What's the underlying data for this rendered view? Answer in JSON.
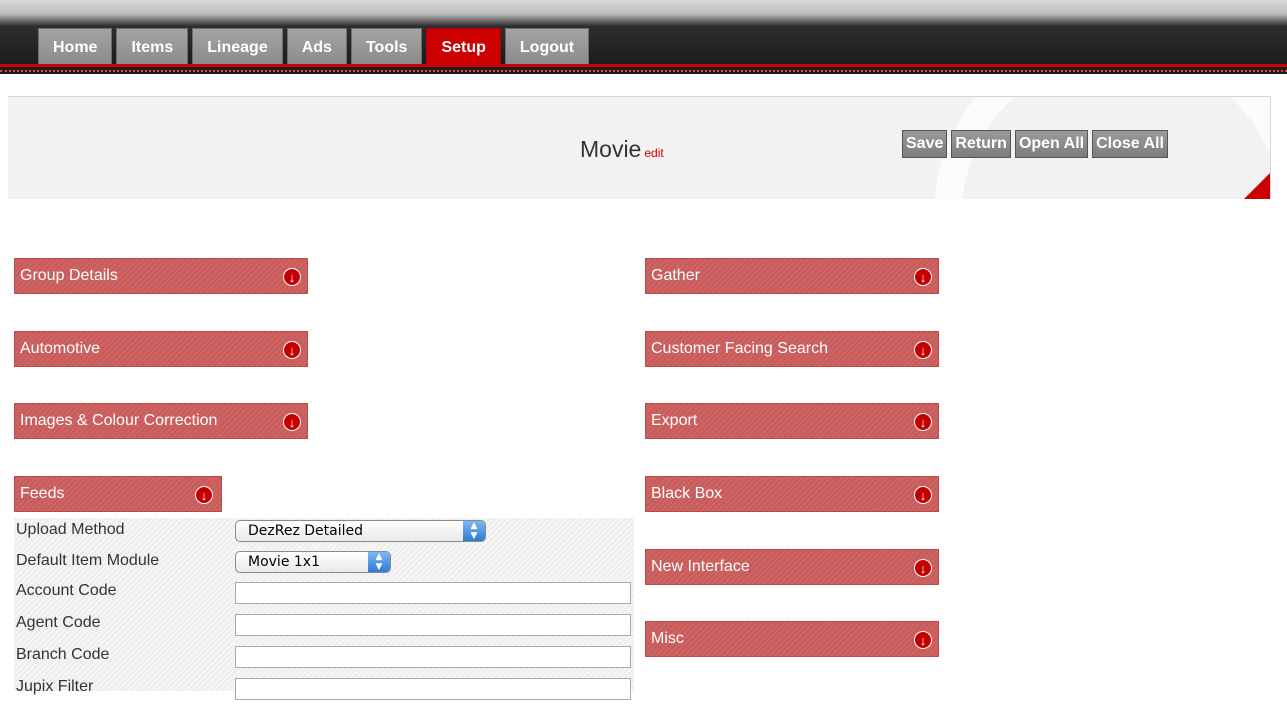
{
  "nav": {
    "tabs": [
      {
        "label": "Home"
      },
      {
        "label": "Items"
      },
      {
        "label": "Lineage"
      },
      {
        "label": "Ads"
      },
      {
        "label": "Tools"
      },
      {
        "label": "Setup",
        "active": true
      },
      {
        "label": "Logout"
      }
    ]
  },
  "header": {
    "title": "Movie",
    "edit_label": "edit",
    "buttons": {
      "save": "Save",
      "return": "Return",
      "open_all": "Open All",
      "close_all": "Close All"
    }
  },
  "sections": {
    "left": [
      {
        "label": "Group Details"
      },
      {
        "label": "Automotive"
      },
      {
        "label": "Images & Colour Correction"
      },
      {
        "label": "Feeds"
      }
    ],
    "right": [
      {
        "label": "Gather"
      },
      {
        "label": "Customer Facing Search"
      },
      {
        "label": "Export"
      },
      {
        "label": "Black Box"
      },
      {
        "label": "New Interface"
      },
      {
        "label": "Misc"
      }
    ]
  },
  "feeds": {
    "upload_method": {
      "label": "Upload Method",
      "value": "DezRez Detailed"
    },
    "default_item_module": {
      "label": "Default Item Module",
      "value": "Movie 1x1"
    },
    "account_code": {
      "label": "Account Code",
      "value": ""
    },
    "agent_code": {
      "label": "Agent Code",
      "value": ""
    },
    "branch_code": {
      "label": "Branch Code",
      "value": ""
    },
    "jupix_filter": {
      "label": "Jupix Filter",
      "value": ""
    }
  },
  "colors": {
    "accent_red": "#cc0000",
    "section_bar": "#c85a5a",
    "nav_dark": "#1c1c1c"
  }
}
